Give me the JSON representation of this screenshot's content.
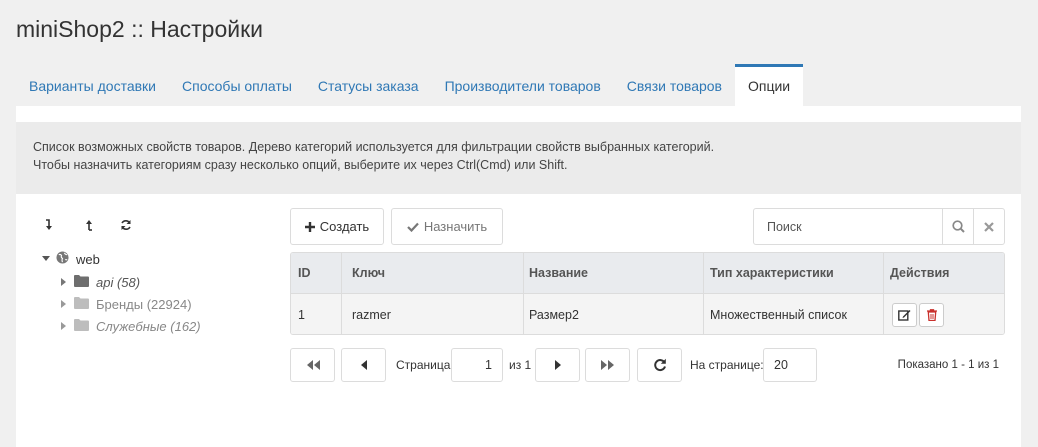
{
  "page": {
    "title": "miniShop2 :: Настройки"
  },
  "tabs": [
    {
      "label": "Варианты доставки"
    },
    {
      "label": "Способы оплаты"
    },
    {
      "label": "Статусы заказа"
    },
    {
      "label": "Производители товаров"
    },
    {
      "label": "Связи товаров"
    },
    {
      "label": "Опции",
      "active": true
    }
  ],
  "info": {
    "line1": "Список возможных свойств товаров. Дерево категорий используется для фильтрации свойств выбранных категорий.",
    "line2": "Чтобы назначить категориям сразу несколько опций, выберите их через Ctrl(Cmd) или Shift."
  },
  "tree": {
    "tools": [
      "expand-icon",
      "collapse-icon",
      "refresh-icon"
    ],
    "root": {
      "label": "web",
      "icon": "globe-icon"
    },
    "nodes": [
      {
        "label": "api (58)",
        "italic": true,
        "icon": "folder-icon"
      },
      {
        "label": "Бренды (22924)",
        "italic": false,
        "icon": "folder-icon"
      },
      {
        "label": "Служебные (162)",
        "italic": true,
        "icon": "folder-icon"
      }
    ]
  },
  "toolbar": {
    "create_label": "Создать",
    "assign_label": "Назначить",
    "search_placeholder": "Поиск"
  },
  "grid": {
    "columns": [
      "ID",
      "Ключ",
      "Название",
      "Тип характеристики",
      "Действия"
    ],
    "rows": [
      {
        "id": "1",
        "key": "razmer",
        "name": "Размер2",
        "type": "Множественный список"
      }
    ]
  },
  "pager": {
    "page_label": "Страница",
    "page_value": "1",
    "of_label": "из 1",
    "per_page_label": "На странице:",
    "per_page_value": "20",
    "shown_label": "Показано 1 - 1 из 1"
  },
  "colors": {
    "accent": "#2f78b5",
    "danger": "#c9302c",
    "background": "#f0f0f0"
  }
}
